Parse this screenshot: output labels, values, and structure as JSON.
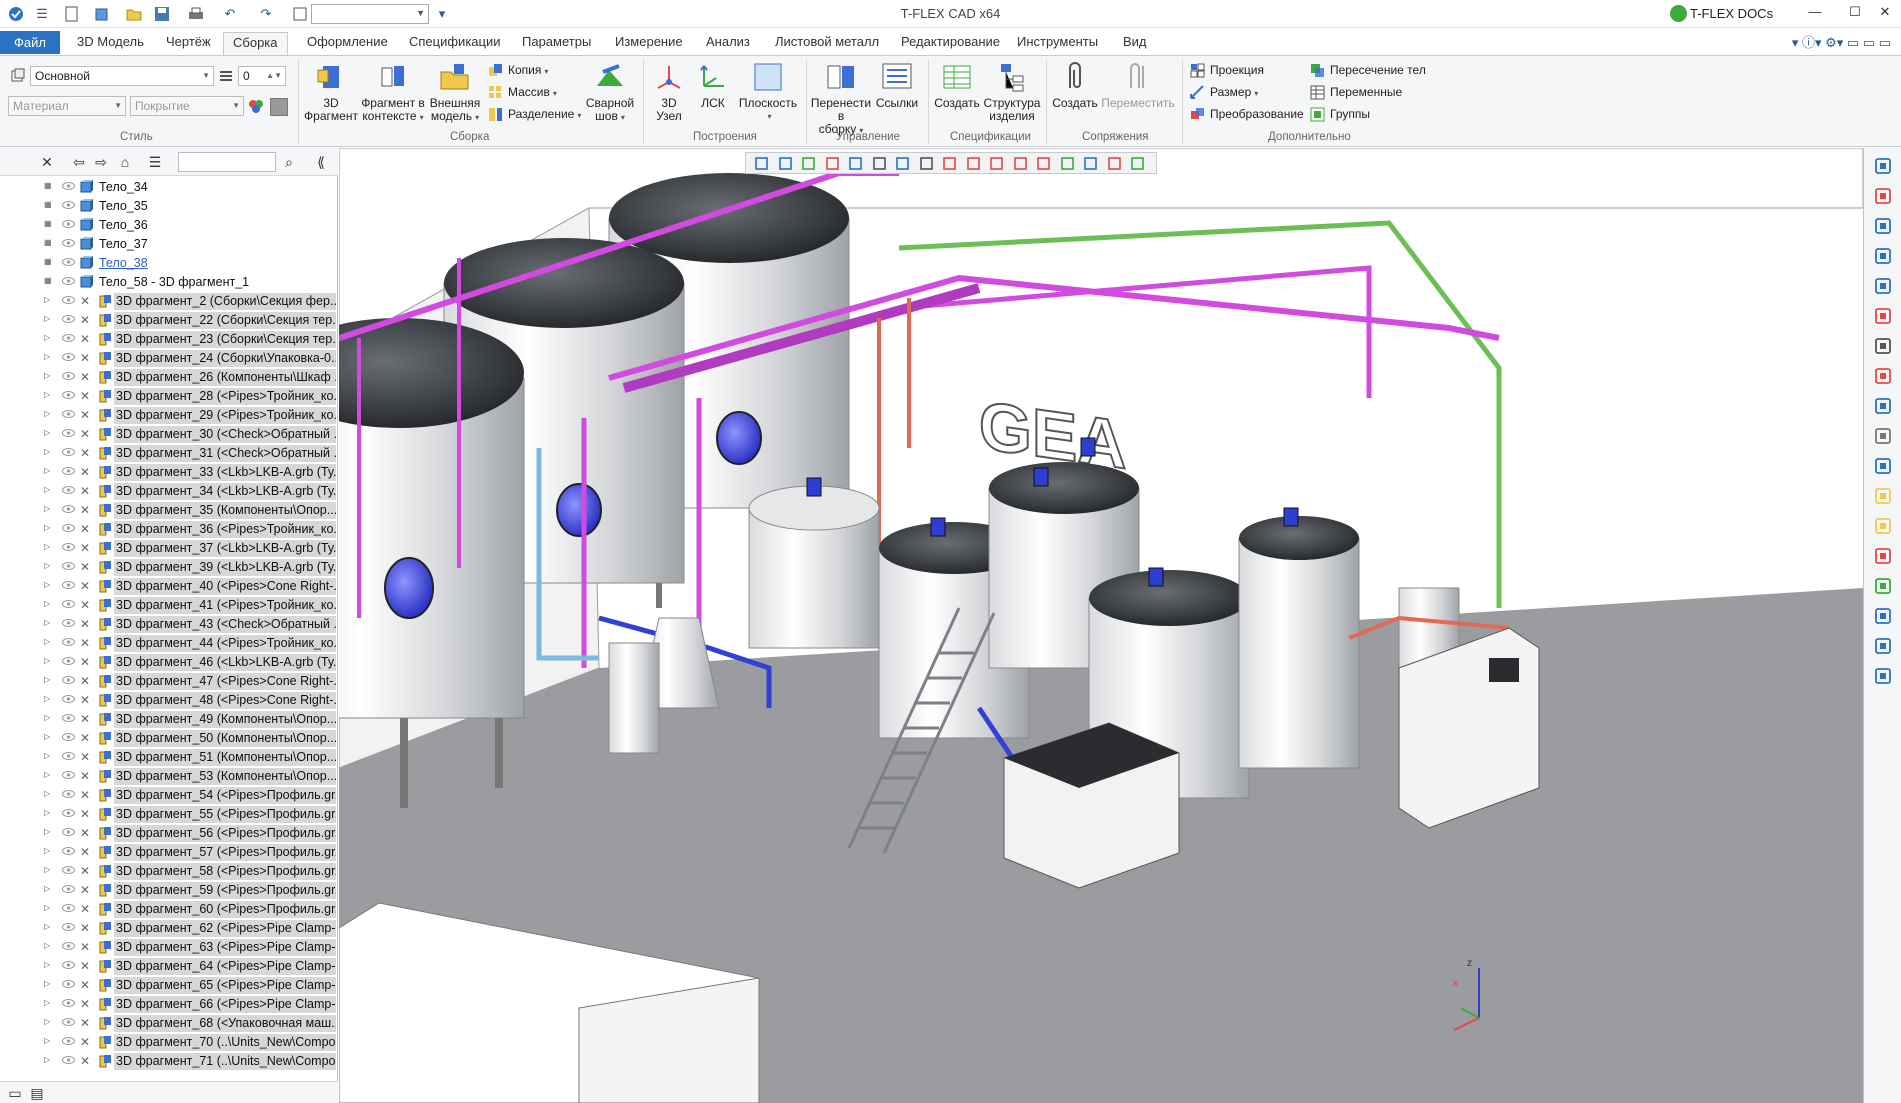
{
  "window": {
    "title": "T-FLEX CAD x64",
    "docs_label": "T-FLEX DOCs"
  },
  "menu": {
    "tabs": [
      "Файл",
      "3D Модель",
      "Чертёж",
      "Сборка",
      "Оформление",
      "Спецификации",
      "Параметры",
      "Измерение",
      "Анализ",
      "Листовой металл",
      "Редактирование",
      "Инструменты",
      "Вид"
    ],
    "active": "Сборка"
  },
  "ribbon": {
    "style": {
      "layer_value": "Основной",
      "number_value": "0",
      "material_placeholder": "Материал",
      "coating_placeholder": "Покрытие",
      "label": "Стиль"
    },
    "assembly": {
      "fragment_3d": [
        "3D",
        "Фрагмент"
      ],
      "fragment_context": [
        "Фрагмент в",
        "контексте"
      ],
      "external_model": [
        "Внешняя",
        "модель"
      ],
      "copy": "Копия",
      "array": "Массив",
      "split": "Разделение",
      "weld": [
        "Сварной",
        "шов"
      ],
      "label": "Сборка"
    },
    "constructions": {
      "node": [
        "3D",
        "Узел"
      ],
      "lsk": "ЛСК",
      "plane": "Плоскость",
      "label": "Построения"
    },
    "management": {
      "move_to": [
        "Перенести в",
        "сборку"
      ],
      "links": "Ссылки",
      "label": "Управление"
    },
    "specifications": {
      "create": "Создать",
      "structure": [
        "Структура",
        "изделия"
      ],
      "label": "Спецификации"
    },
    "mates": {
      "create": "Создать",
      "move": "Переместить",
      "label": "Сопряжения"
    },
    "additional": {
      "projection": "Проекция",
      "size": "Размер",
      "transform": "Преобразование",
      "intersection": "Пересечение тел",
      "variables": "Переменные",
      "groups": "Группы",
      "label": "Дополнительно"
    }
  },
  "tree": {
    "bodies": [
      "Тело_34",
      "Тело_35",
      "Тело_36",
      "Тело_37",
      "Тело_38",
      "Тело_58 - 3D фрагмент_1"
    ],
    "fragments": [
      "3D фрагмент_2 (Сборки\\Секция фер...",
      "3D фрагмент_22 (Сборки\\Секция тер...",
      "3D фрагмент_23 (Сборки\\Секция тер...",
      "3D фрагмент_24 (Сборки\\Упаковка-0...",
      "3D фрагмент_26 (Компоненты\\Шкаф ...",
      "3D фрагмент_28 (<Pipes>Тройник_ко...",
      "3D фрагмент_29 (<Pipes>Тройник_ко...",
      "3D фрагмент_30 (<Check>Обратный ...",
      "3D фрагмент_31 (<Check>Обратный ...",
      "3D фрагмент_33 (<Lkb>LKB-A.grb (Ту...",
      "3D фрагмент_34 (<Lkb>LKB-A.grb (Ту...",
      "3D фрагмент_35 (Компоненты\\Опор...",
      "3D фрагмент_36 (<Pipes>Тройник_ко...",
      "3D фрагмент_37 (<Lkb>LKB-A.grb (Ту...",
      "3D фрагмент_39 (<Lkb>LKB-A.grb (Ту...",
      "3D фрагмент_40 (<Pipes>Cone Right-...",
      "3D фрагмент_41 (<Pipes>Тройник_ко...",
      "3D фрагмент_43 (<Check>Обратный ...",
      "3D фрагмент_44 (<Pipes>Тройник_ко...",
      "3D фрагмент_46 (<Lkb>LKB-A.grb (Ту...",
      "3D фрагмент_47 (<Pipes>Cone Right-...",
      "3D фрагмент_48 (<Pipes>Cone Right-...",
      "3D фрагмент_49 (Компоненты\\Опор...",
      "3D фрагмент_50 (Компоненты\\Опор...",
      "3D фрагмент_51 (Компоненты\\Опор...",
      "3D фрагмент_53 (Компоненты\\Опор...",
      "3D фрагмент_54 (<Pipes>Профиль.gr...",
      "3D фрагмент_55 (<Pipes>Профиль.gr...",
      "3D фрагмент_56 (<Pipes>Профиль.gr...",
      "3D фрагмент_57 (<Pipes>Профиль.gr...",
      "3D фрагмент_58 (<Pipes>Профиль.gr...",
      "3D фрагмент_59 (<Pipes>Профиль.gr...",
      "3D фрагмент_60 (<Pipes>Профиль.gr...",
      "3D фрагмент_62 (<Pipes>Pipe Clamp-...",
      "3D фрагмент_63 (<Pipes>Pipe Clamp-...",
      "3D фрагмент_64 (<Pipes>Pipe Clamp-...",
      "3D фрагмент_65 (<Pipes>Pipe Clamp-...",
      "3D фрагмент_66 (<Pipes>Pipe Clamp-...",
      "3D фрагмент_68 (<Упаковочная маш...",
      "3D фрагмент_70 (..\\Units_New\\Compo...",
      "3D фрагмент_71 (..\\Units_New\\Compo..."
    ]
  },
  "viewport": {
    "logo_text": "GEA"
  },
  "colors": {
    "accent": "#2b73c2",
    "pipe_magenta": "#d24be0",
    "pipe_blue": "#3140d6",
    "floor": "#9a9c9f"
  }
}
